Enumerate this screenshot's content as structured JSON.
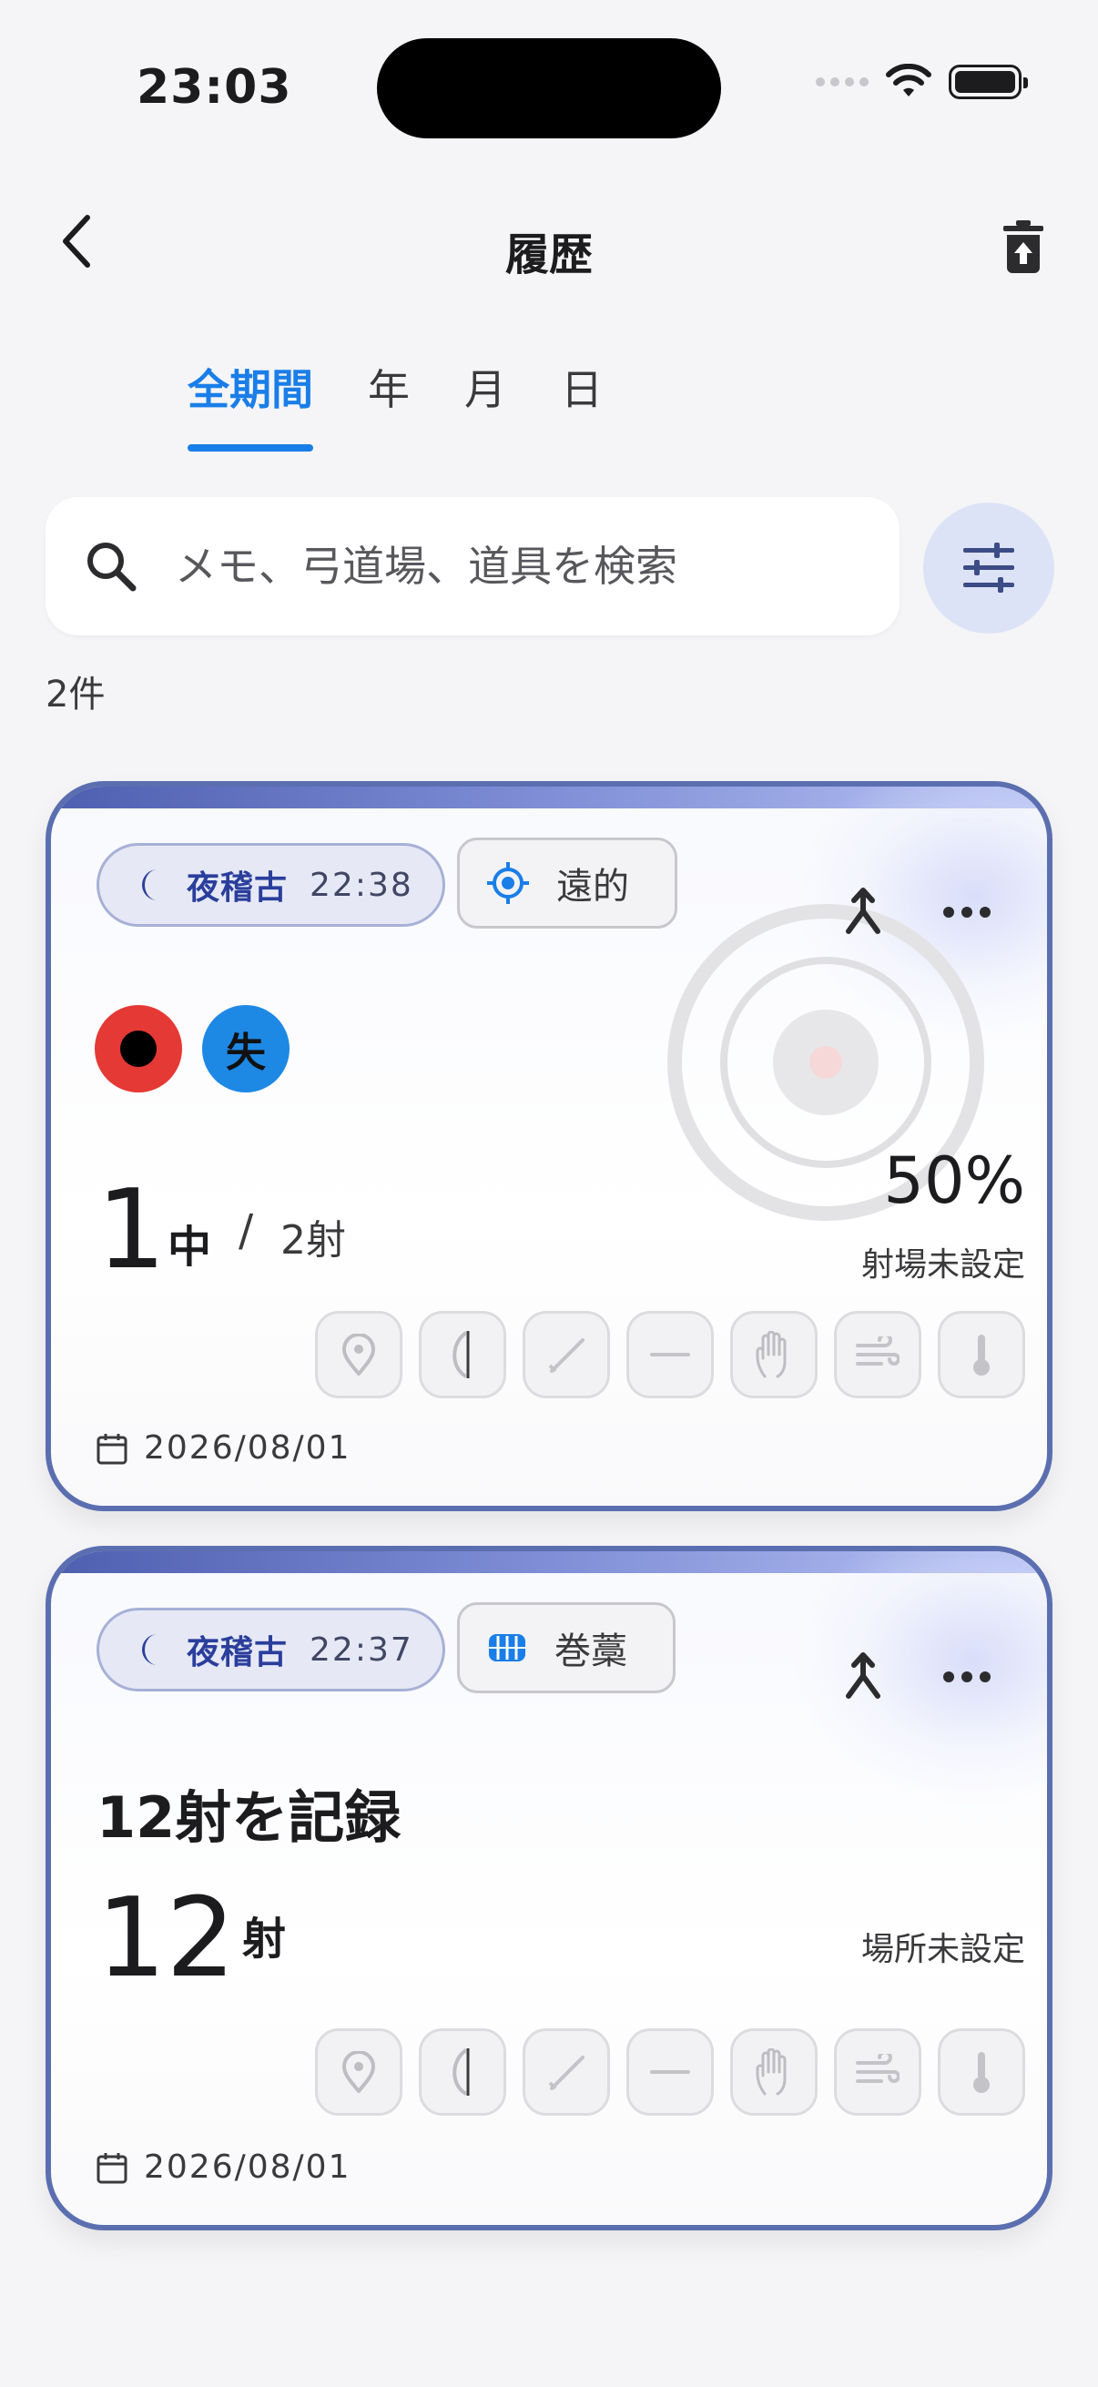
{
  "status": {
    "time": "23:03"
  },
  "nav": {
    "title": "履歴"
  },
  "tabs": [
    {
      "label": "全期間",
      "active": true
    },
    {
      "label": "年",
      "active": false
    },
    {
      "label": "月",
      "active": false
    },
    {
      "label": "日",
      "active": false
    }
  ],
  "search": {
    "placeholder": "メモ、弓道場、道具を検索",
    "value": ""
  },
  "result_count": "2件",
  "colors": {
    "accent": "#1a7ee8",
    "card_border": "#5b6fb0",
    "hit_red": "#e53935",
    "miss_blue": "#1e88e5"
  },
  "cards": [
    {
      "session_label": "夜稽古",
      "session_time": "22:38",
      "mode_label": "遠的",
      "mode_icon": "target-icon",
      "shots": [
        {
          "icon": "hit-dot-icon",
          "result": "hit"
        },
        {
          "icon": "miss",
          "text": "失"
        }
      ],
      "hits": "1",
      "hits_unit": "中",
      "slash": "/",
      "total": "2射",
      "rate": "50%",
      "place": "射場未設定",
      "date": "2026/08/01"
    },
    {
      "session_label": "夜稽古",
      "session_time": "22:37",
      "mode_label": "巻藁",
      "mode_icon": "makiwara-icon",
      "title": "12射を記録",
      "count": "12",
      "count_unit": "射",
      "place": "場所未設定",
      "date": "2026/08/01"
    }
  ],
  "tool_icons": [
    "location-icon",
    "bow-icon",
    "arrow-icon",
    "string-icon",
    "glove-icon",
    "wind-icon",
    "thermometer-icon"
  ]
}
